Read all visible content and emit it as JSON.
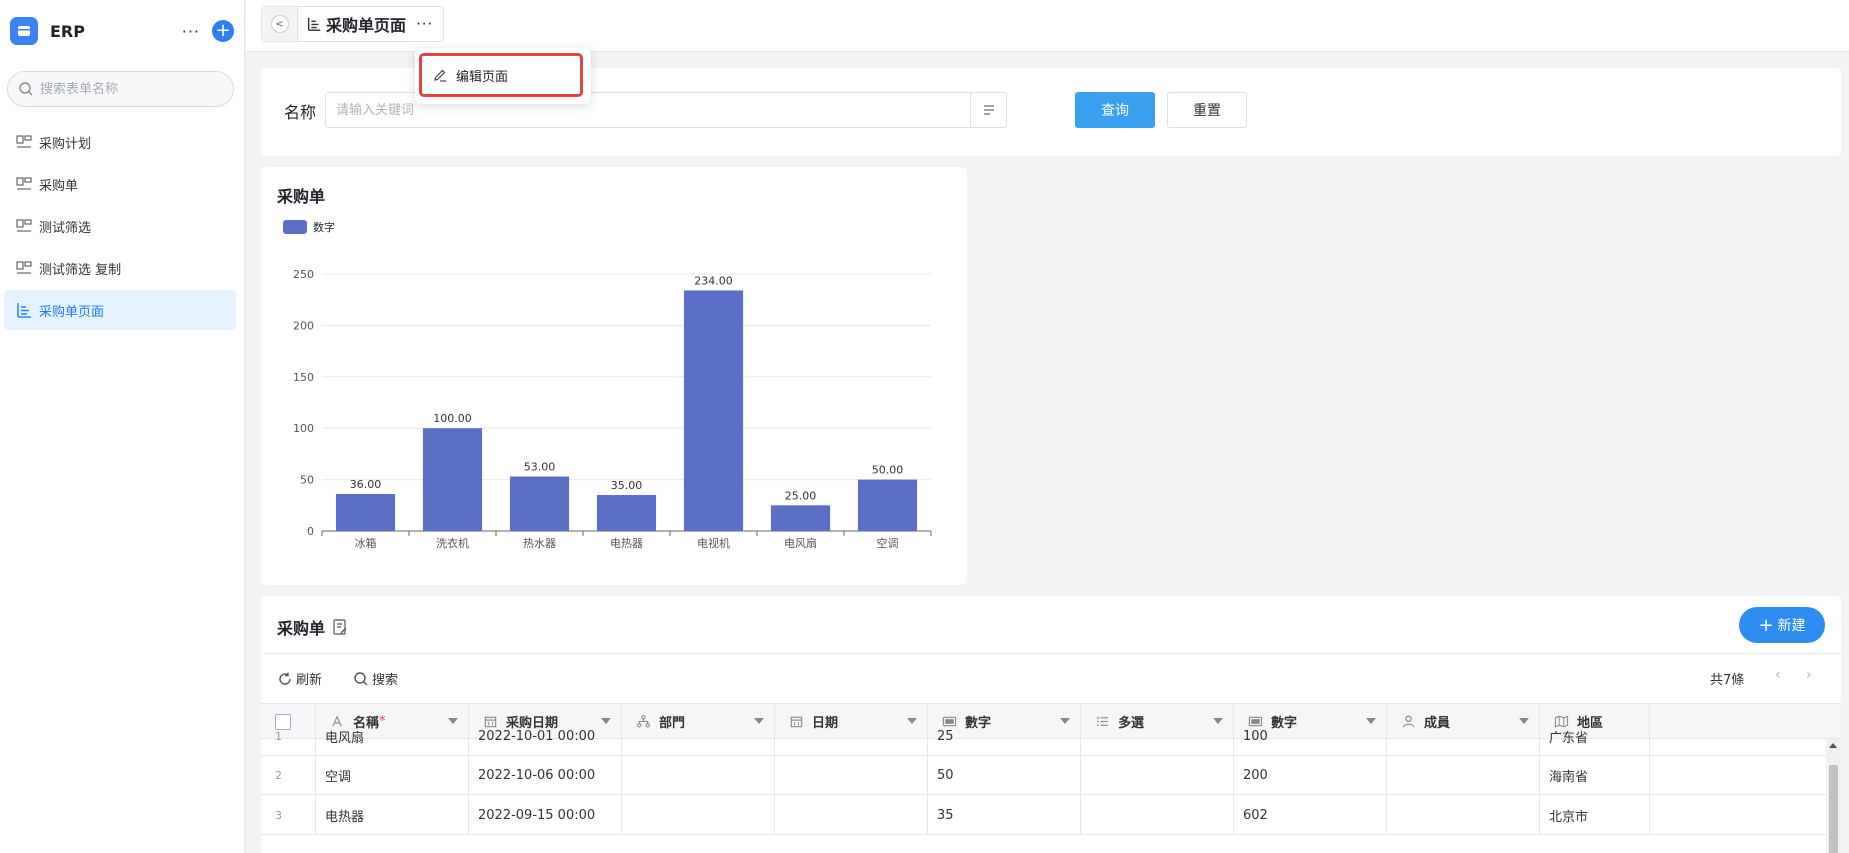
{
  "app": {
    "title": "ERP",
    "more": "···",
    "add": "+"
  },
  "sidebar": {
    "search_placeholder": "搜索表单名称",
    "items": [
      {
        "label": "采购计划"
      },
      {
        "label": "采购单"
      },
      {
        "label": "测试筛选"
      },
      {
        "label": "测试筛选 复制"
      },
      {
        "label": "采购单页面"
      }
    ]
  },
  "topbar": {
    "back": "<",
    "tab_title": "采购单页面",
    "tab_more": "···",
    "menu_item": "编辑页面"
  },
  "filter": {
    "label": "名称",
    "placeholder": "请输入关键词",
    "query": "查询",
    "reset": "重置"
  },
  "colors": {
    "bar": "#5b6fc7",
    "accent": "#2f8cf0",
    "active_bg": "#e6f2ff"
  },
  "chart_data": {
    "type": "bar",
    "title": "采购单",
    "legend": [
      "数字"
    ],
    "legend_position": "top-left",
    "grid": true,
    "categories": [
      "冰箱",
      "洗衣机",
      "热水器",
      "电热器",
      "电视机",
      "电风扇",
      "空调"
    ],
    "series": [
      {
        "name": "数字",
        "values": [
          36,
          100,
          53,
          35,
          234,
          25,
          50
        ]
      }
    ],
    "data_labels": [
      "36.00",
      "100.00",
      "53.00",
      "35.00",
      "234.00",
      "25.00",
      "50.00"
    ],
    "yticks": [
      "0",
      "50",
      "100",
      "150",
      "200",
      "250"
    ],
    "ylim": [
      0,
      250
    ]
  },
  "table": {
    "title": "采购单",
    "new_button": "新建",
    "refresh": "刷新",
    "search": "搜索",
    "total": "共7條",
    "prev": "‹",
    "next": "›",
    "columns": [
      {
        "label": "名稱",
        "icon": "text-icon",
        "required": true
      },
      {
        "label": "采购日期",
        "icon": "calendar-icon"
      },
      {
        "label": "部門",
        "icon": "org-icon"
      },
      {
        "label": "日期",
        "icon": "calendar-icon"
      },
      {
        "label": "數字",
        "icon": "number-icon"
      },
      {
        "label": "多選",
        "icon": "list-icon"
      },
      {
        "label": "數字",
        "icon": "number-icon"
      },
      {
        "label": "成員",
        "icon": "person-icon"
      },
      {
        "label": "地區",
        "icon": "map-icon"
      }
    ],
    "required_mark": "*",
    "rows": [
      {
        "idx": "1",
        "name": "电风扇",
        "date": "2022-10-01 00:00",
        "dept": "",
        "day": "",
        "num1": "25",
        "multi": "",
        "num2": "100",
        "member": "",
        "region": "广东省"
      },
      {
        "idx": "2",
        "name": "空调",
        "date": "2022-10-06 00:00",
        "dept": "",
        "day": "",
        "num1": "50",
        "multi": "",
        "num2": "200",
        "member": "",
        "region": "海南省"
      },
      {
        "idx": "3",
        "name": "电热器",
        "date": "2022-09-15 00:00",
        "dept": "",
        "day": "",
        "num1": "35",
        "multi": "",
        "num2": "602",
        "member": "",
        "region": "北京市"
      }
    ]
  }
}
